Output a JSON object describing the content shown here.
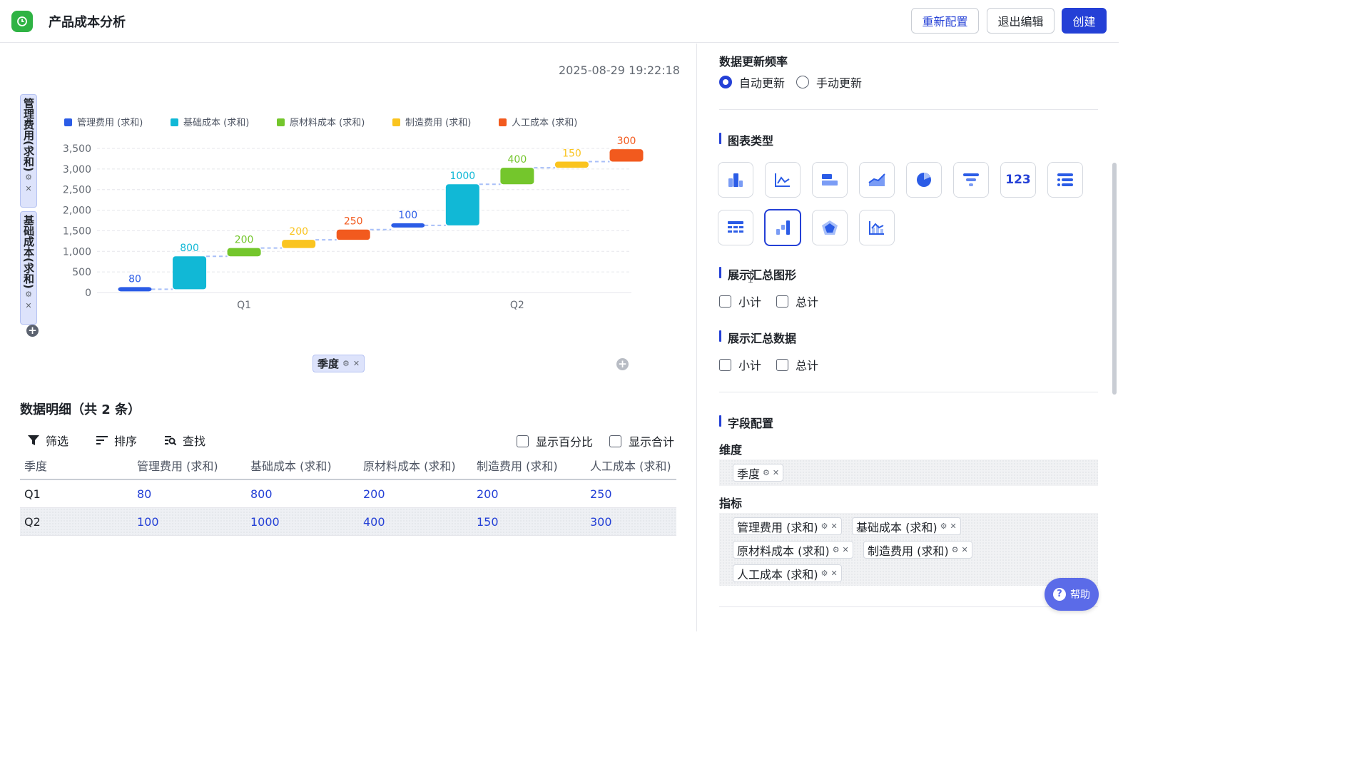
{
  "header": {
    "title": "产品成本分析",
    "buttons": {
      "reconfigure": "重新配置",
      "exit_edit": "退出编辑",
      "create": "创建"
    }
  },
  "timestamp": "2025-08-29 19:22:18",
  "y_field_chips": [
    {
      "label": "管理费用(求和)"
    },
    {
      "label": "基础成本(求和)"
    }
  ],
  "x_field_chip": "季度",
  "chart_data": {
    "type": "bar",
    "subtype": "waterfall",
    "categories": [
      "Q1",
      "Q2"
    ],
    "series": [
      {
        "name": "管理费用 (求和)",
        "color": "#2b5ce6",
        "values": [
          80,
          100
        ]
      },
      {
        "name": "基础成本 (求和)",
        "color": "#11b8d6",
        "values": [
          800,
          1000
        ]
      },
      {
        "name": "原材料成本 (求和)",
        "color": "#74c62c",
        "values": [
          200,
          400
        ]
      },
      {
        "name": "制造费用 (求和)",
        "color": "#fac41f",
        "values": [
          200,
          150
        ]
      },
      {
        "name": "人工成本 (求和)",
        "color": "#f25a1e",
        "values": [
          250,
          300
        ]
      }
    ],
    "y_ticks": [
      "0",
      "500",
      "1,000",
      "1,500",
      "2,000",
      "2,500",
      "3,000",
      "3,500"
    ],
    "ylim": [
      0,
      3500
    ],
    "legend_position": "top-left",
    "grid": true
  },
  "detail": {
    "title": "数据明细（共 2 条）",
    "toolbar": {
      "filter": "筛选",
      "sort": "排序",
      "search": "查找",
      "show_percent": "显示百分比",
      "show_total": "显示合计"
    },
    "columns": [
      "季度",
      "管理费用 (求和)",
      "基础成本 (求和)",
      "原材料成本 (求和)",
      "制造费用 (求和)",
      "人工成本 (求和)"
    ],
    "rows": [
      [
        "Q1",
        "80",
        "800",
        "200",
        "200",
        "250"
      ],
      [
        "Q2",
        "100",
        "1000",
        "400",
        "150",
        "300"
      ]
    ]
  },
  "side": {
    "update_freq_label": "数据更新频率",
    "update_auto": "自动更新",
    "update_manual": "手动更新",
    "chart_type_label": "图表类型",
    "chart_type_number_icon": "123",
    "chart_types": [
      "bar-chart-icon",
      "line-chart-icon",
      "horizontal-bar-icon",
      "area-chart-icon",
      "pie-chart-icon",
      "funnel-chart-icon",
      "number-card-icon",
      "list-icon",
      "table-icon",
      "waterfall-chart-icon",
      "radar-chart-icon",
      "combo-chart-icon"
    ],
    "summary_shape_label": "展示汇总图形",
    "summary_data_label": "展示汇总数据",
    "subtotal": "小计",
    "total": "总计",
    "field_config_label": "字段配置",
    "dimension_label": "维度",
    "dimension_tags": [
      "季度"
    ],
    "metric_label": "指标",
    "metric_tags": [
      "管理费用 (求和)",
      "基础成本 (求和)",
      "原材料成本 (求和)",
      "制造费用 (求和)",
      "人工成本 (求和)"
    ],
    "help": "帮助"
  }
}
